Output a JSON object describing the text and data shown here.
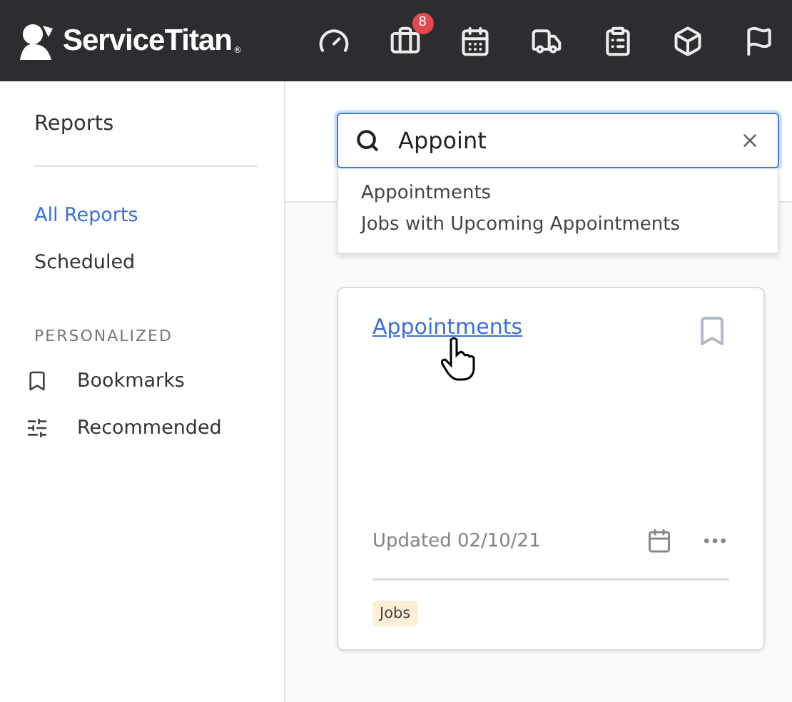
{
  "topbar": {
    "brand": "ServiceTitan",
    "brand_mark": "®",
    "nav": [
      {
        "kind": "gauge"
      },
      {
        "kind": "briefcase",
        "badge": "8"
      },
      {
        "kind": "calendar"
      },
      {
        "kind": "truck"
      },
      {
        "kind": "clipboard"
      },
      {
        "kind": "box"
      },
      {
        "kind": "flag"
      }
    ]
  },
  "sidebar": {
    "title": "Reports",
    "items": [
      {
        "label": "All Reports",
        "selected": true
      },
      {
        "label": "Scheduled",
        "selected": false
      }
    ],
    "section": "PERSONALIZED",
    "personal": [
      {
        "kind": "bookmark",
        "label": "Bookmarks"
      },
      {
        "kind": "sliders",
        "label": "Recommended"
      }
    ]
  },
  "search": {
    "value": "Appoint",
    "suggestions": [
      "Appointments",
      "Jobs with Upcoming Appointments"
    ]
  },
  "card": {
    "title": "Appointments",
    "bookmarked": false,
    "updated": "Updated 02/10/21",
    "tag": "Jobs"
  }
}
